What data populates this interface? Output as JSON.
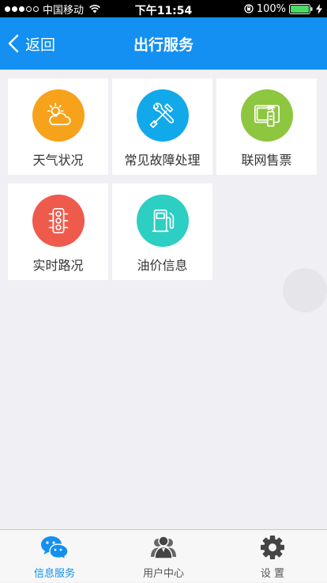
{
  "status_bar": {
    "carrier": "中国移动",
    "time": "下午11:54",
    "battery": "100%"
  },
  "nav": {
    "back_label": "返回",
    "title": "出行服务"
  },
  "tiles": [
    {
      "label": "天气状况",
      "icon": "weather-icon",
      "color": "#f7a21b"
    },
    {
      "label": "常见故障处理",
      "icon": "tools-icon",
      "color": "#12a9ea"
    },
    {
      "label": "联网售票",
      "icon": "ticket-terminal-icon",
      "color": "#8dc63f"
    },
    {
      "label": "实时路况",
      "icon": "traffic-light-icon",
      "color": "#ee5a4c"
    },
    {
      "label": "油价信息",
      "icon": "fuel-pump-icon",
      "color": "#2ccfc2"
    }
  ],
  "tabs": [
    {
      "label": "信息服务",
      "icon": "chat-bubbles-icon",
      "active": true
    },
    {
      "label": "用户中心",
      "icon": "users-icon",
      "active": false
    },
    {
      "label": "设 置",
      "icon": "gear-icon",
      "active": false
    }
  ],
  "colors": {
    "accent": "#1390f1",
    "background": "#efeff4"
  }
}
